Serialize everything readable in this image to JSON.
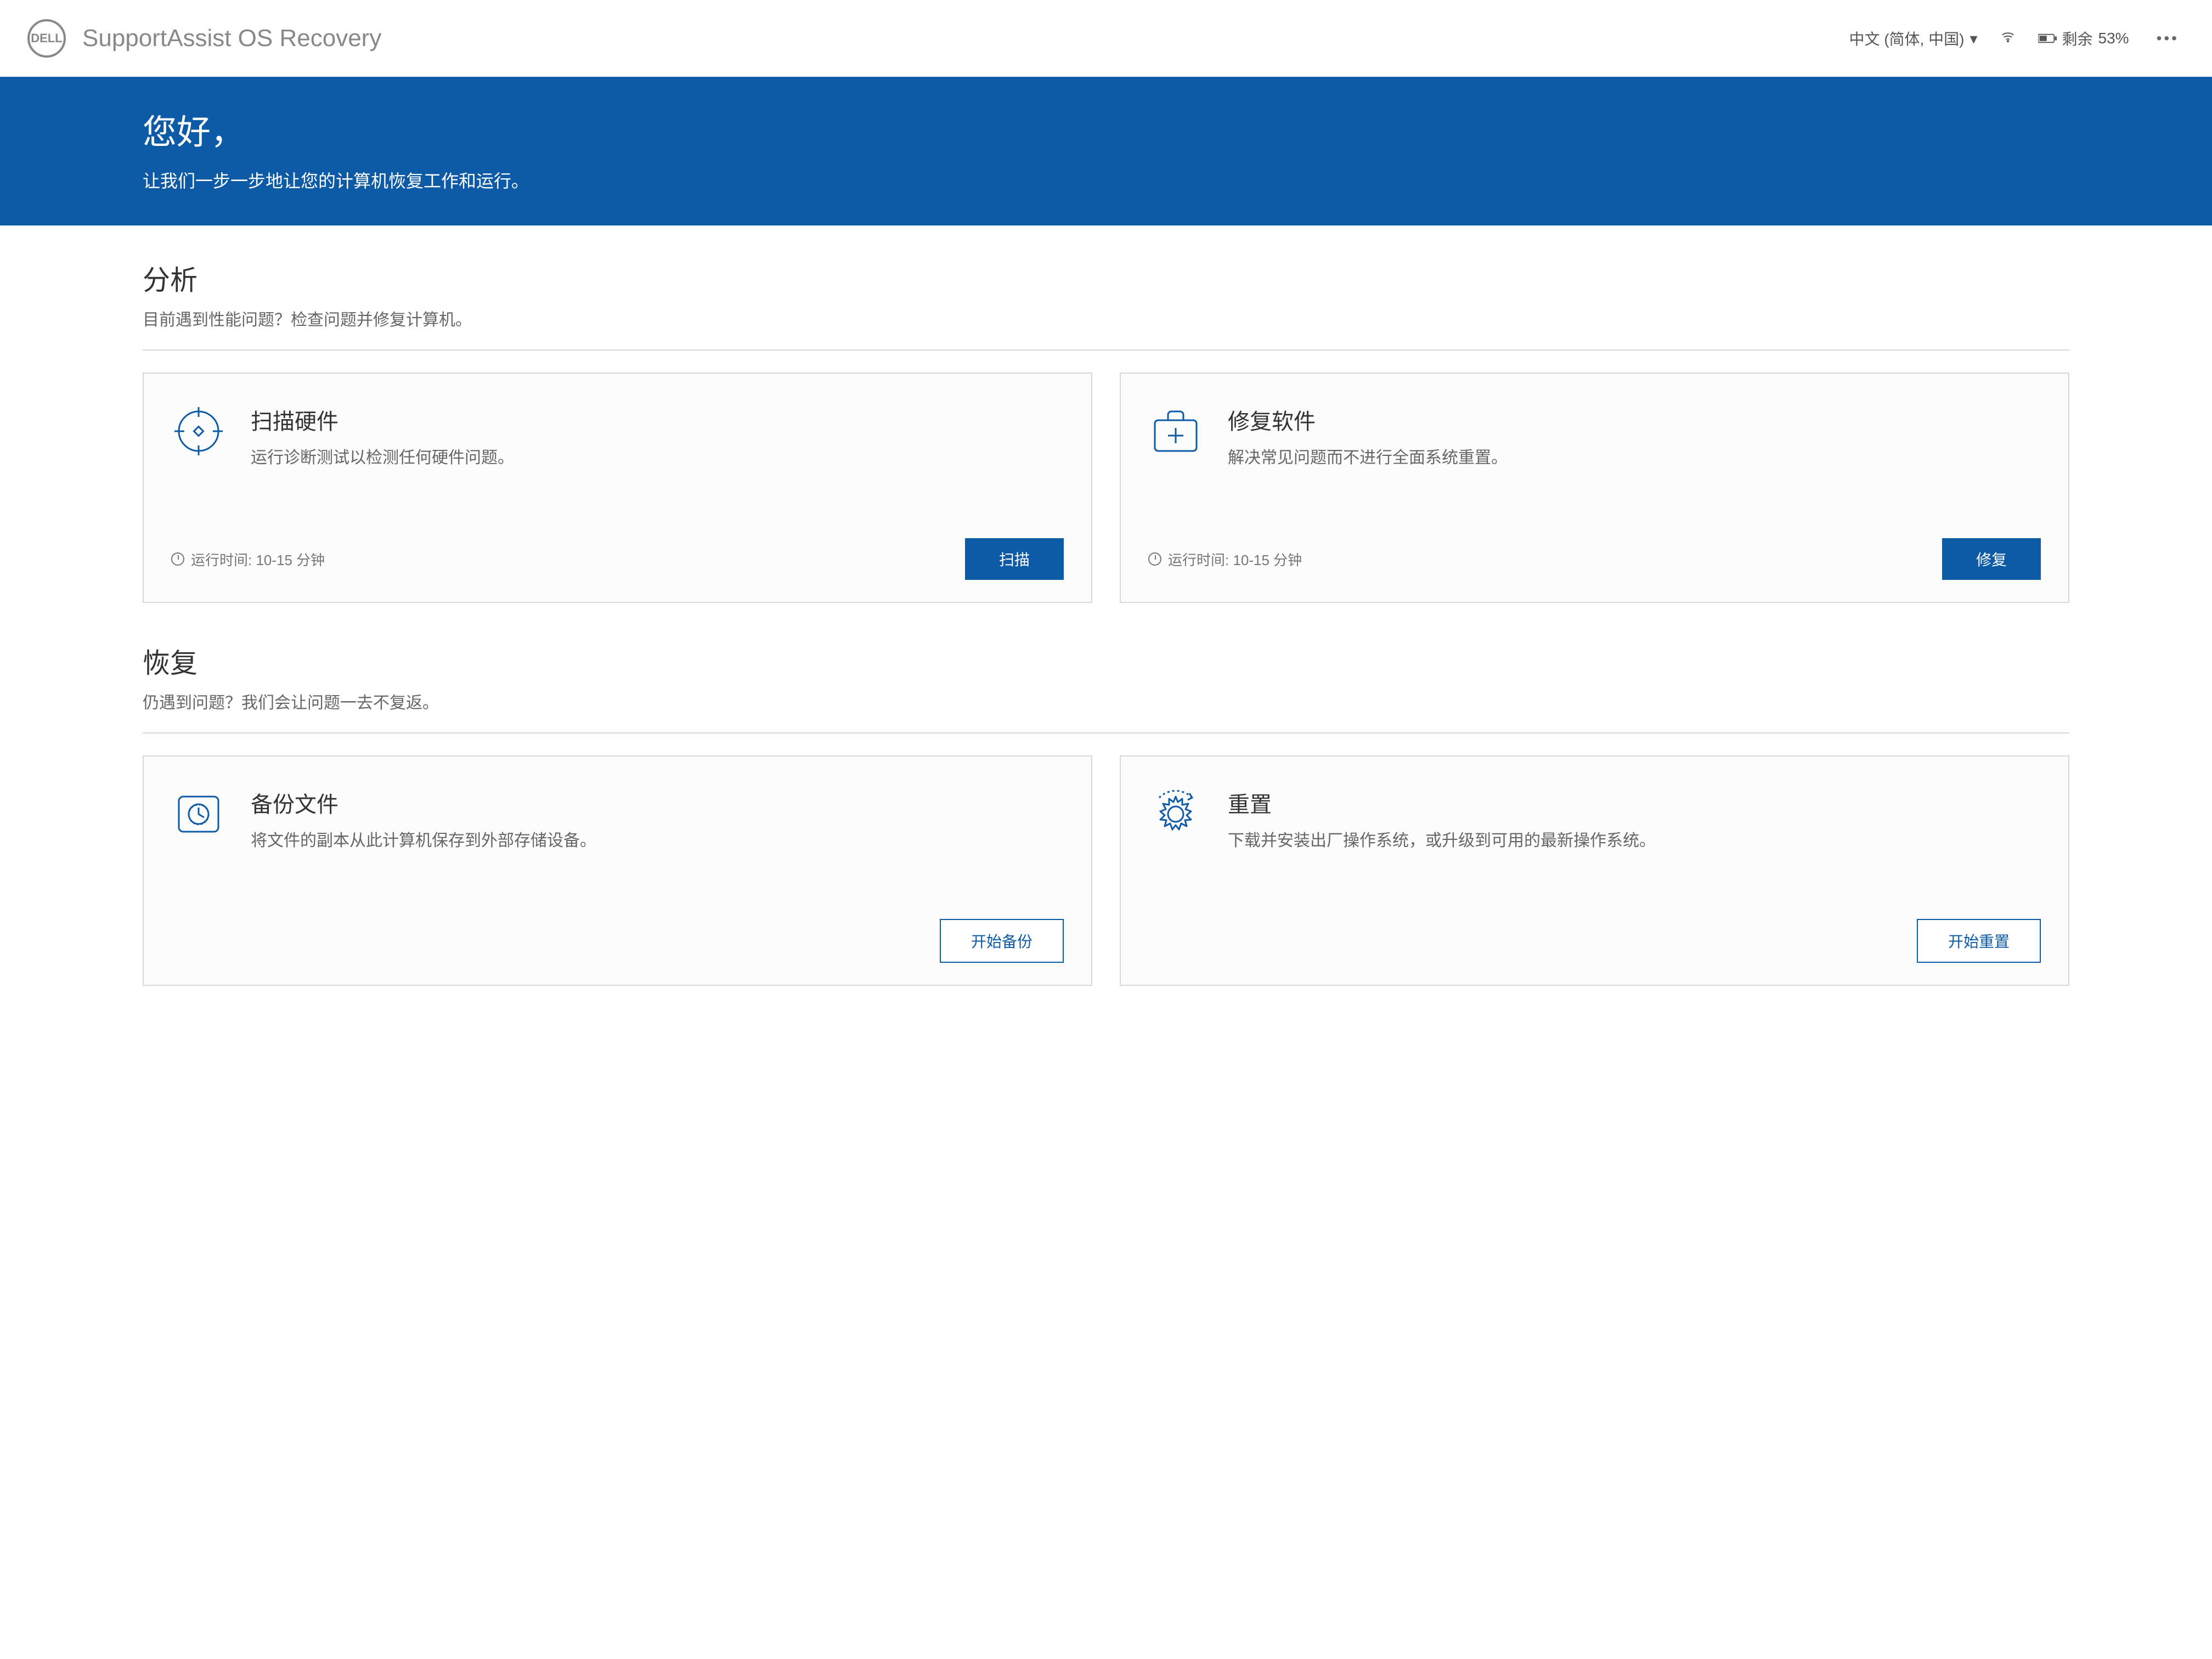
{
  "topbar": {
    "logo_text": "DELL",
    "app_title": "SupportAssist OS Recovery",
    "language": "中文 (简体, 中国)",
    "battery_percent": "53%",
    "battery_label": "剩余"
  },
  "banner": {
    "greeting": "您好，",
    "subtitle": "让我们一步一步地让您的计算机恢复工作和运行。"
  },
  "sections": {
    "analyze": {
      "title": "分析",
      "subtitle": "目前遇到性能问题？检查问题并修复计算机。",
      "cards": {
        "scan_hw": {
          "title": "扫描硬件",
          "desc": "运行诊断测试以检测任何硬件问题。",
          "runtime": "运行时间: 10-15 分钟",
          "button": "扫描"
        },
        "repair_sw": {
          "title": "修复软件",
          "desc": "解决常见问题而不进行全面系统重置。",
          "runtime": "运行时间: 10-15 分钟",
          "button": "修复"
        }
      }
    },
    "recover": {
      "title": "恢复",
      "subtitle": "仍遇到问题？我们会让问题一去不复返。",
      "cards": {
        "backup": {
          "title": "备份文件",
          "desc": "将文件的副本从此计算机保存到外部存储设备。",
          "button": "开始备份"
        },
        "reset": {
          "title": "重置",
          "desc": "下载并安装出厂操作系统，或升级到可用的最新操作系统。",
          "button": "开始重置"
        }
      }
    }
  }
}
